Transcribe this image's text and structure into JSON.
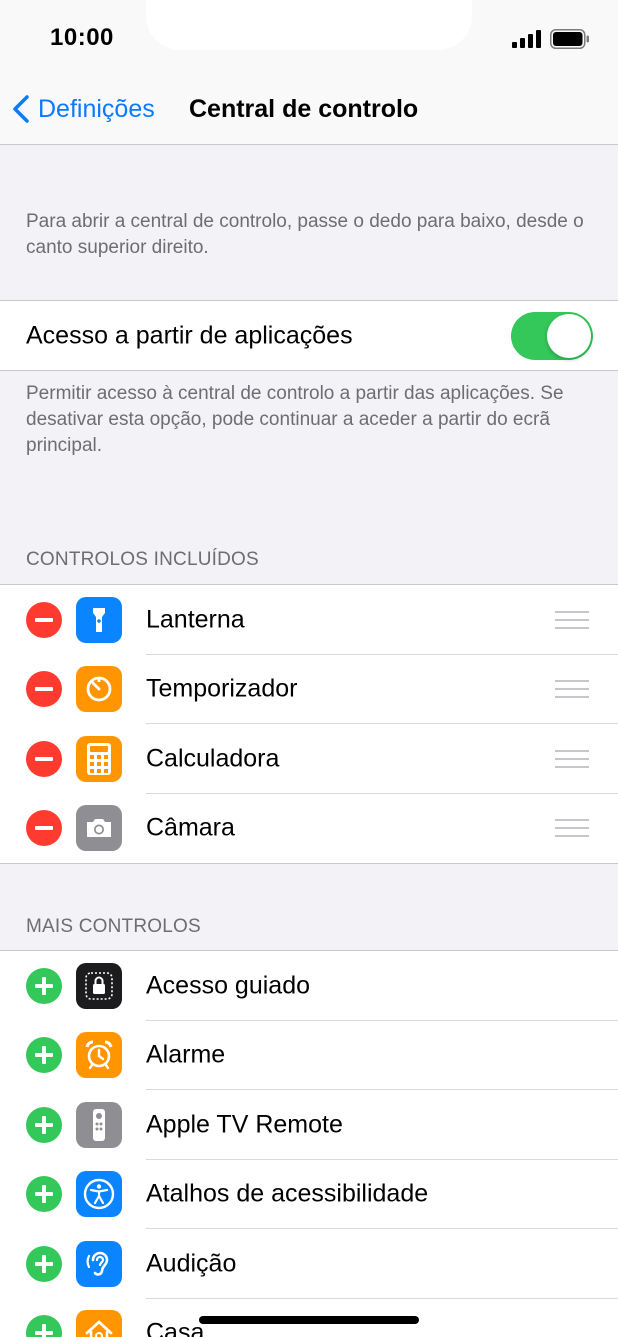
{
  "status_bar": {
    "time": "10:00"
  },
  "nav": {
    "back_label": "Definições",
    "title": "Central de controlo"
  },
  "intro_text": "Para abrir a central de controlo, passe o dedo para baixo, desde o canto superior direito.",
  "access_toggle": {
    "label": "Acesso a partir de aplicações",
    "on": true,
    "color": "#34c759"
  },
  "access_footnote": "Permitir acesso à central de controlo a partir das aplicações. Se desativar esta opção, pode continuar a aceder a partir do ecrã principal.",
  "included_header": "CONTROLOS INCLUÍDOS",
  "included_controls": [
    {
      "label": "Lanterna",
      "icon": "flashlight-icon",
      "color": "#0a84ff"
    },
    {
      "label": "Temporizador",
      "icon": "timer-icon",
      "color": "#ff9500"
    },
    {
      "label": "Calculadora",
      "icon": "calculator-icon",
      "color": "#ff9500"
    },
    {
      "label": "Câmara",
      "icon": "camera-icon",
      "color": "#8e8e93"
    }
  ],
  "more_header": "MAIS CONTROLOS",
  "more_controls": [
    {
      "label": "Acesso guiado",
      "icon": "guided-access-icon",
      "color": "#1c1c1e"
    },
    {
      "label": "Alarme",
      "icon": "alarm-icon",
      "color": "#ff9500"
    },
    {
      "label": "Apple TV Remote",
      "icon": "apple-tv-remote-icon",
      "color": "#8e8e93"
    },
    {
      "label": "Atalhos de acessibilidade",
      "icon": "accessibility-icon",
      "color": "#0a84ff"
    },
    {
      "label": "Audição",
      "icon": "hearing-icon",
      "color": "#0a84ff"
    },
    {
      "label": "Casa",
      "icon": "home-icon",
      "color": "#ff9500"
    }
  ],
  "colors": {
    "accent": "#0a7aff",
    "remove": "#ff3b30",
    "add": "#34c759",
    "background": "#f2f2f7"
  }
}
